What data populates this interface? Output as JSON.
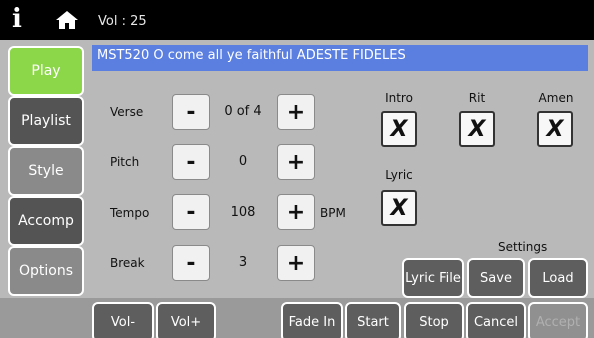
{
  "topbar": {
    "vol_label": "Vol : 25",
    "info_icon": "info-icon",
    "home_icon": "home-icon"
  },
  "sidebar": {
    "items": [
      {
        "label": "Play",
        "style": "active"
      },
      {
        "label": "Playlist",
        "style": "dark"
      },
      {
        "label": "Style",
        "style": "grey"
      },
      {
        "label": "Accomp",
        "style": "dark"
      },
      {
        "label": "Options",
        "style": "grey"
      }
    ]
  },
  "song": {
    "title": "MST520  O come all ye faithful  ADESTE FIDELES"
  },
  "controls": {
    "verse": {
      "label": "Verse",
      "value": "0 of 4",
      "minus": "-",
      "plus": "+"
    },
    "pitch": {
      "label": "Pitch",
      "value": "0",
      "minus": "-",
      "plus": "+"
    },
    "tempo": {
      "label": "Tempo",
      "value": "108",
      "minus": "-",
      "plus": "+",
      "unit": "BPM"
    },
    "break": {
      "label": "Break",
      "value": "3",
      "minus": "-",
      "plus": "+"
    }
  },
  "toggles": {
    "intro": {
      "label": "Intro",
      "mark": "X"
    },
    "rit": {
      "label": "Rit",
      "mark": "X"
    },
    "amen": {
      "label": "Amen",
      "mark": "X"
    },
    "lyric": {
      "label": "Lyric",
      "mark": "X"
    }
  },
  "settings": {
    "label": "Settings",
    "lyric_file": "Lyric File",
    "save": "Save",
    "load": "Load"
  },
  "bottom": {
    "vol_minus": "Vol-",
    "vol_plus": "Vol+",
    "fade_in": "Fade In",
    "start": "Start",
    "stop": "Stop",
    "cancel": "Cancel",
    "accept": "Accept"
  },
  "colors": {
    "active": "#8cd64a",
    "song_bar": "#5b7fe0",
    "panel": "#b9b9b9",
    "dark_button": "#545454"
  }
}
